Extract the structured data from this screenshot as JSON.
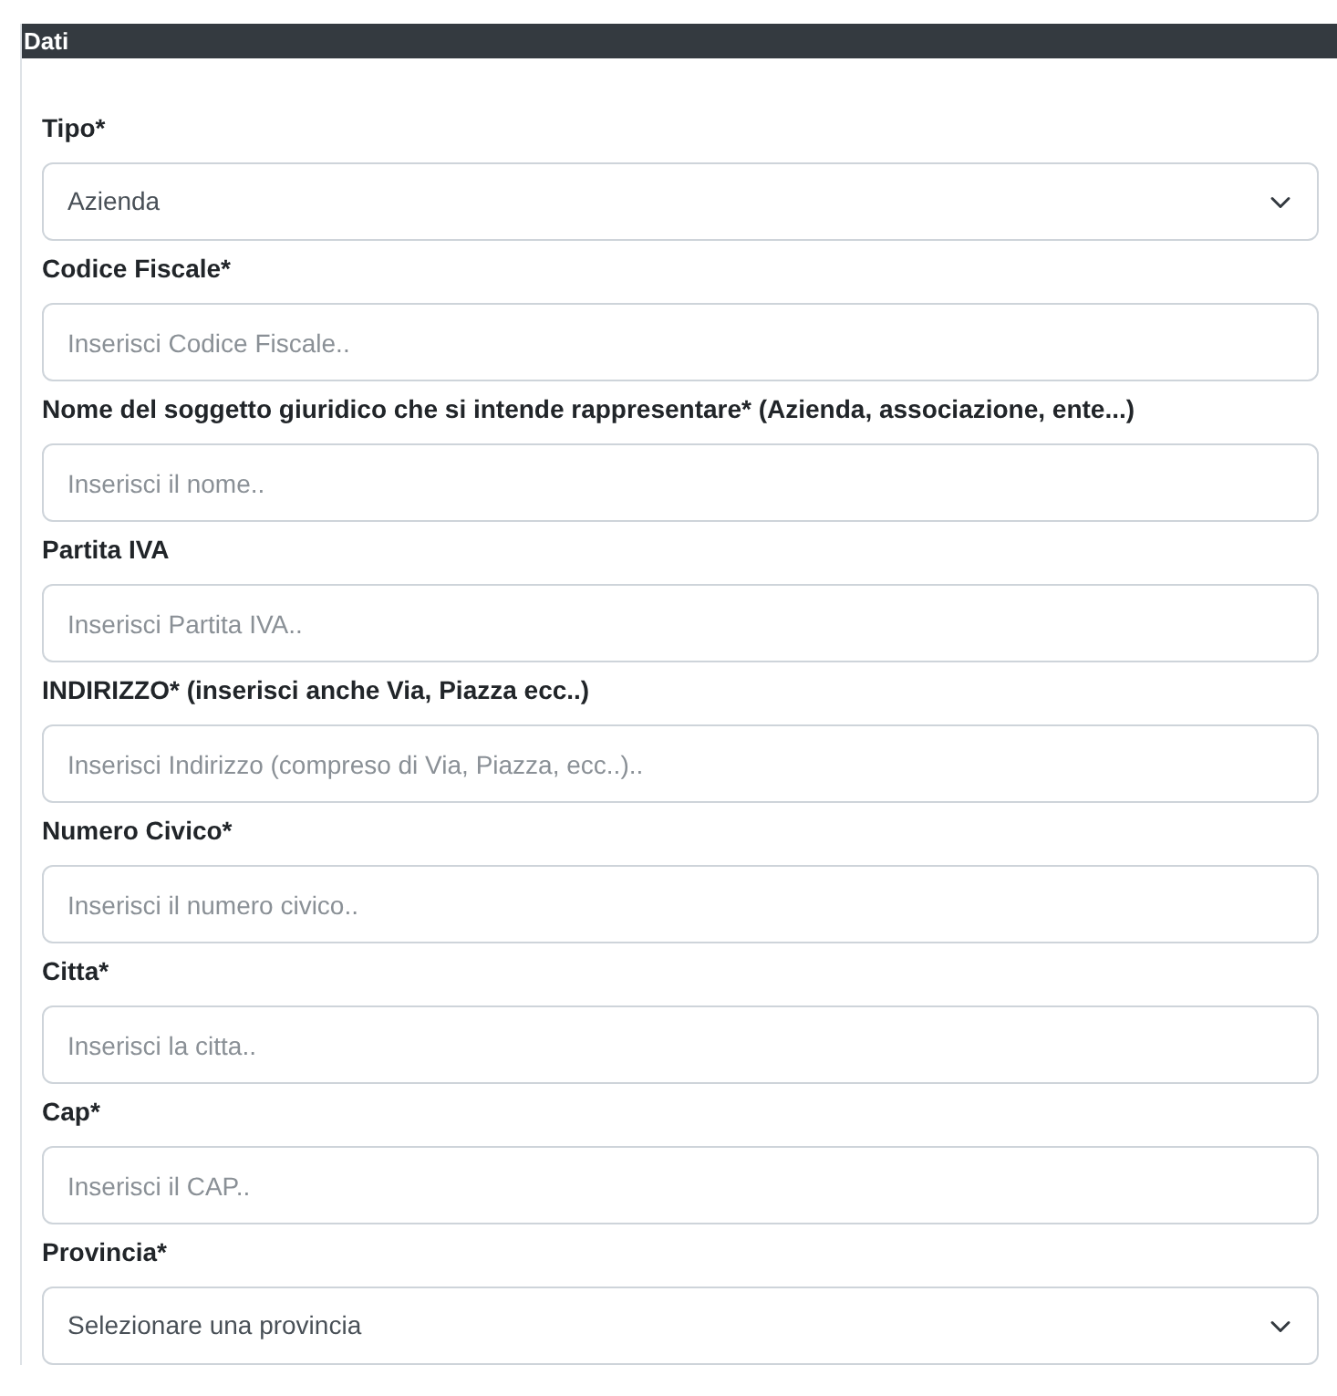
{
  "panel": {
    "title": "Dati"
  },
  "fields": [
    {
      "kind": "select",
      "label": "Tipo*",
      "value": "Azienda"
    },
    {
      "kind": "input",
      "label": "Codice Fiscale*",
      "placeholder": "Inserisci Codice Fiscale.."
    },
    {
      "kind": "input",
      "label": "Nome del soggetto giuridico che si intende rappresentare* (Azienda, associazione, ente...)",
      "placeholder": "Inserisci il nome.."
    },
    {
      "kind": "input",
      "label": "Partita IVA",
      "placeholder": "Inserisci Partita IVA.."
    },
    {
      "kind": "input",
      "label": "INDIRIZZO* (inserisci anche Via, Piazza ecc..)",
      "placeholder": "Inserisci Indirizzo (compreso di Via, Piazza, ecc..).."
    },
    {
      "kind": "input",
      "label": "Numero Civico*",
      "placeholder": "Inserisci il numero civico.."
    },
    {
      "kind": "input",
      "label": "Citta*",
      "placeholder": "Inserisci la citta.."
    },
    {
      "kind": "input",
      "label": "Cap*",
      "placeholder": "Inserisci il CAP.."
    },
    {
      "kind": "select",
      "label": "Provincia*",
      "value": "Selezionare una provincia"
    }
  ]
}
